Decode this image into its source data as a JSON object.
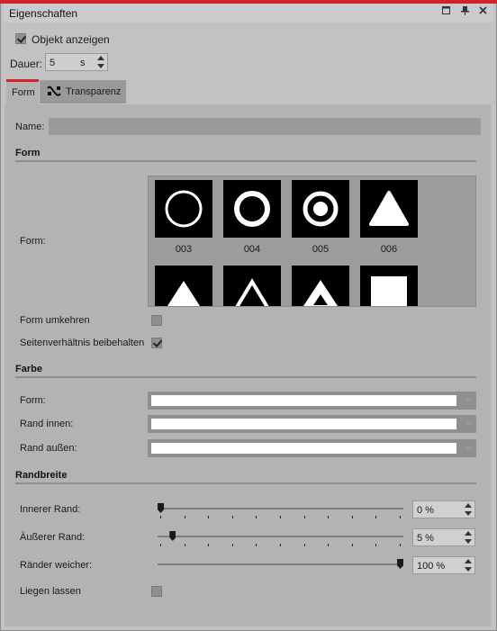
{
  "panel": {
    "title": "Eigenschaften"
  },
  "titlebar_icons": [
    "minimize-icon",
    "pin-icon",
    "close-icon"
  ],
  "general": {
    "show_object_label": "Objekt anzeigen",
    "show_object_checked": true,
    "duration_label": "Dauer:",
    "duration_value": "5",
    "duration_unit": "s"
  },
  "tabs": [
    {
      "label": "Form",
      "active": true
    },
    {
      "label": "Transparenz",
      "active": false
    }
  ],
  "name": {
    "label": "Name:",
    "value": ""
  },
  "form_section": {
    "heading": "Form",
    "shape_label": "Form:",
    "shapes": [
      {
        "label": "003",
        "icon": "ring-thin-icon"
      },
      {
        "label": "004",
        "icon": "ring-thick-icon"
      },
      {
        "label": "005",
        "icon": "target-icon"
      },
      {
        "label": "006",
        "icon": "triangle-rounded-icon"
      },
      {
        "label": "",
        "icon": "triangle-filled-icon"
      },
      {
        "label": "",
        "icon": "triangle-outline-icon"
      },
      {
        "label": "",
        "icon": "triangle-inset-icon"
      },
      {
        "label": "",
        "icon": "square-icon"
      }
    ],
    "invert_label": "Form umkehren",
    "invert_checked": false,
    "keep_ratio_label": "Seitenverhältnis beibehalten",
    "keep_ratio_checked": true
  },
  "color_section": {
    "heading": "Farbe",
    "rows": [
      {
        "label": "Form:",
        "color": "#ffffff"
      },
      {
        "label": "Rand innen:",
        "color": "#ffffff"
      },
      {
        "label": "Rand außen:",
        "color": "#ffffff"
      }
    ]
  },
  "border_section": {
    "heading": "Randbreite",
    "sliders": [
      {
        "label": "Innerer Rand:",
        "value_text": "0 %",
        "fraction": 0.0
      },
      {
        "label": "Äußerer Rand:",
        "value_text": "5 %",
        "fraction": 0.05
      },
      {
        "label": "Ränder weicher:",
        "value_text": "100 %",
        "fraction": 1.0
      }
    ],
    "lay_label": "Liegen lassen",
    "lay_checked": false
  },
  "colors": {
    "accent": "#d2232a",
    "panel_bg": "#b3b3b3"
  }
}
